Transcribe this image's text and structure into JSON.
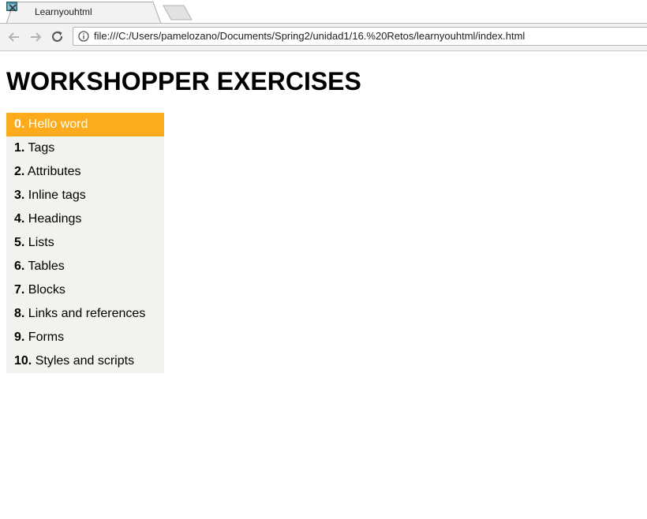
{
  "browser": {
    "tab_title": "Learnyouhtml",
    "url": "file:///C:/Users/pamelozano/Documents/Spring2/unidad1/16.%20Retos/learnyouhtml/index.html"
  },
  "page": {
    "title": "WORKSHOPPER EXERCISES",
    "active_color": "#fcab1c",
    "list_background": "#f2f2ee",
    "exercises": [
      {
        "number": "0.",
        "label": " Hello word",
        "active": true
      },
      {
        "number": "1.",
        "label": " Tags",
        "active": false
      },
      {
        "number": "2.",
        "label": " Attributes",
        "active": false
      },
      {
        "number": "3.",
        "label": " Inline tags",
        "active": false
      },
      {
        "number": "4.",
        "label": " Headings",
        "active": false
      },
      {
        "number": "5.",
        "label": " Lists",
        "active": false
      },
      {
        "number": "6.",
        "label": " Tables",
        "active": false
      },
      {
        "number": "7.",
        "label": " Blocks",
        "active": false
      },
      {
        "number": "8.",
        "label": " Links and references",
        "active": false
      },
      {
        "number": "9.",
        "label": " Forms",
        "active": false
      },
      {
        "number": "10.",
        "label": " Styles and scripts",
        "active": false
      }
    ]
  }
}
